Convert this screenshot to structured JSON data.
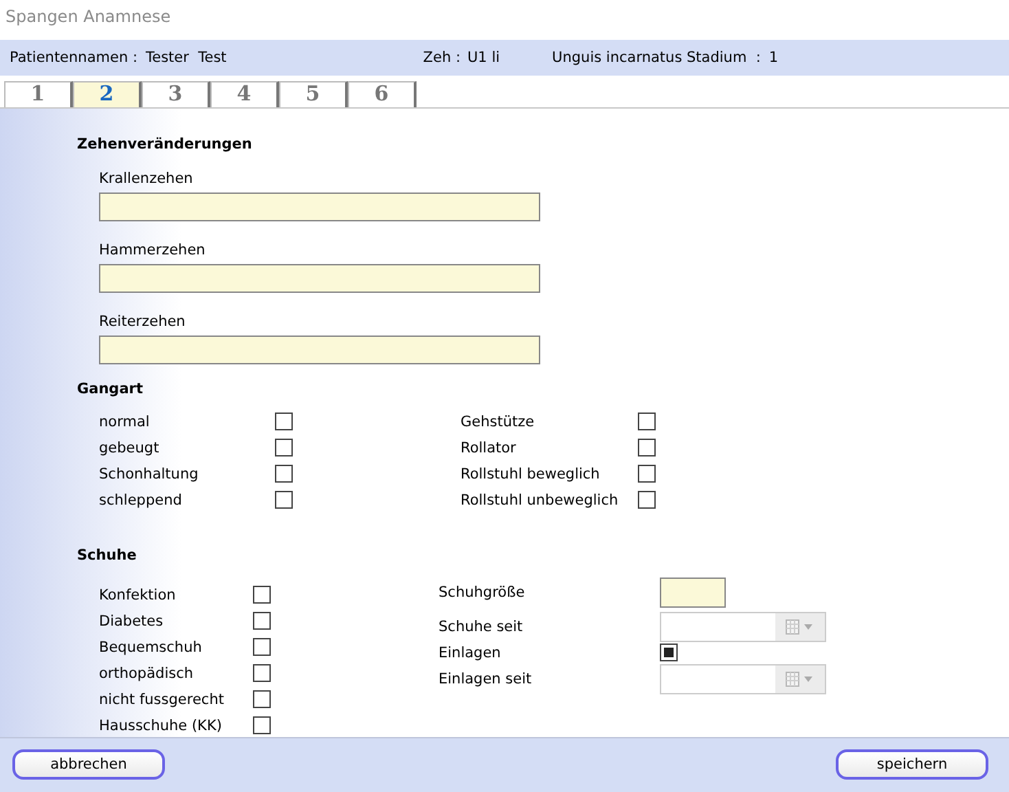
{
  "window": {
    "title": "Spangen Anamnese"
  },
  "header": {
    "patient_label": "Patientennamen :",
    "patient_name": "Tester  Test",
    "toe_label": "Zeh :",
    "toe_value": "U1 li",
    "stadium_label": "Unguis incarnatus Stadium  :",
    "stadium_value": "1"
  },
  "tabs": [
    {
      "label": "1",
      "selected": false
    },
    {
      "label": "2",
      "selected": true
    },
    {
      "label": "3",
      "selected": false
    },
    {
      "label": "4",
      "selected": false
    },
    {
      "label": "5",
      "selected": false
    },
    {
      "label": "6",
      "selected": false
    }
  ],
  "toe_changes": {
    "title": "Zehenveränderungen",
    "fields": [
      {
        "label": "Krallenzehen"
      },
      {
        "label": "Hammerzehen"
      },
      {
        "label": "Reiterzehen"
      }
    ]
  },
  "gait": {
    "title": "Gangart",
    "left": [
      {
        "label": "normal",
        "checked": false
      },
      {
        "label": "gebeugt",
        "checked": false
      },
      {
        "label": "Schonhaltung",
        "checked": false
      },
      {
        "label": "schleppend",
        "checked": false
      }
    ],
    "right": [
      {
        "label": "Gehstütze",
        "checked": false
      },
      {
        "label": "Rollator",
        "checked": false
      },
      {
        "label": "Rollstuhl beweglich",
        "checked": false
      },
      {
        "label": "Rollstuhl unbeweglich",
        "checked": false
      }
    ]
  },
  "shoes": {
    "title": "Schuhe",
    "left": [
      {
        "label": "Konfektion",
        "checked": false
      },
      {
        "label": "Diabetes",
        "checked": false
      },
      {
        "label": "Bequemschuh",
        "checked": false
      },
      {
        "label": "orthopädisch",
        "checked": false
      },
      {
        "label": "nicht fussgerecht",
        "checked": false
      },
      {
        "label": "Hausschuhe (KK)",
        "checked": false
      }
    ],
    "right": [
      {
        "kind": "text",
        "label": "Schuhgröße"
      },
      {
        "kind": "date",
        "label": "Schuhe seit"
      },
      {
        "kind": "checkbox",
        "label": "Einlagen",
        "checked": true
      },
      {
        "kind": "date",
        "label": "Einlagen seit"
      }
    ]
  },
  "buttons": {
    "cancel": "abbrechen",
    "save": "speichern"
  }
}
